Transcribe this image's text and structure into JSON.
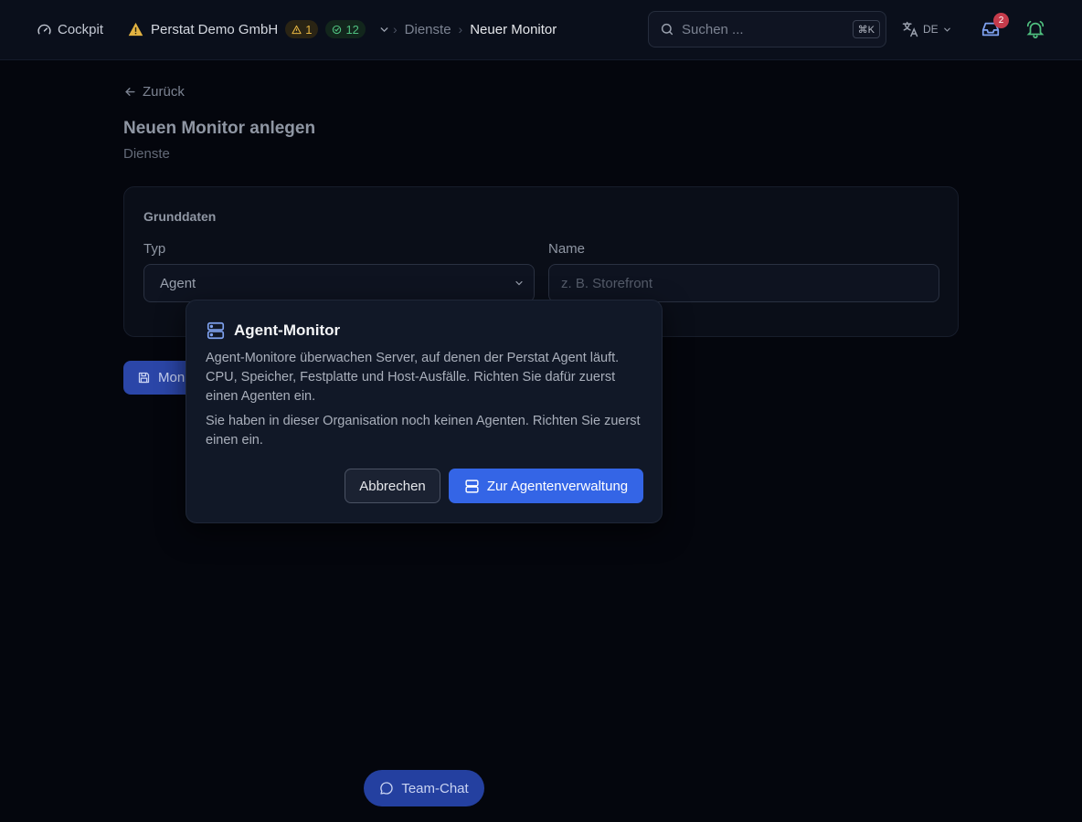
{
  "topbar": {
    "cockpit_label": "Cockpit",
    "org_name": "Perstat Demo GmbH",
    "warning_count": "1",
    "ok_count": "12",
    "breadcrumbs": [
      "Dienste",
      "Neuer Monitor"
    ],
    "search_placeholder": "Suchen ...",
    "search_shortcut": "⌘K",
    "language": "DE",
    "inbox_badge": "2"
  },
  "page": {
    "back_label": "Zurück",
    "title": "Neuen Monitor anlegen",
    "subtitle": "Dienste"
  },
  "form": {
    "section_title": "Grunddaten",
    "type_label": "Typ",
    "type_value": "Agent",
    "name_label": "Name",
    "name_placeholder": "z. B. Storefront",
    "save_label": "Mon"
  },
  "modal": {
    "title": "Agent-Monitor",
    "paragraph1": "Agent-Monitore überwachen Server, auf denen der Perstat Agent läuft. CPU, Speicher, Festplatte und Host-Ausfälle. Richten Sie dafür zuerst einen Agenten ein.",
    "paragraph2": "Sie haben in dieser Organisation noch keinen Agenten. Richten Sie zuerst einen ein.",
    "cancel_label": "Abbrechen",
    "primary_label": "Zur Agentenverwaltung"
  },
  "chat": {
    "label": "Team-Chat"
  },
  "colors": {
    "background": "#04060d",
    "primary": "#3465e6",
    "warning": "#e3b341",
    "success": "#4fbf7f",
    "badge": "#c53b4b"
  }
}
